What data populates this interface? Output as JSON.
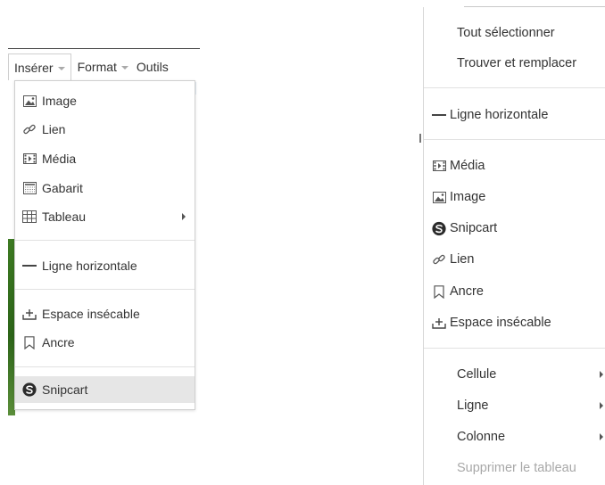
{
  "left_panel": {
    "menubar": {
      "insert_label": "Insérer",
      "format_label": "Format",
      "tools_label": "Outils"
    },
    "menu": {
      "image": "Image",
      "link": "Lien",
      "media": "Média",
      "template": "Gabarit",
      "table": "Tableau",
      "horizontal_line": "Ligne horizontale",
      "nonbreaking_space": "Espace insécable",
      "anchor": "Ancre",
      "snipcart": "Snipcart"
    }
  },
  "right_panel": {
    "menu": {
      "select_all": "Tout sélectionner",
      "find_replace": "Trouver et remplacer",
      "horizontal_line": "Ligne horizontale",
      "media": "Média",
      "image": "Image",
      "snipcart": "Snipcart",
      "link": "Lien",
      "anchor": "Ancre",
      "nonbreaking_space": "Espace insécable",
      "cell": "Cellule",
      "row": "Ligne",
      "column": "Colonne",
      "delete_table": "Supprimer le tableau"
    }
  },
  "icons": {
    "image": "image-icon",
    "link": "link-icon",
    "media": "media-icon",
    "template": "template-icon",
    "table": "table-icon",
    "horizontal_line": "horizontal-line-icon",
    "nonbreaking_space": "nonbreaking-space-icon",
    "anchor": "bookmark-icon",
    "snipcart": "snipcart-icon",
    "submenu": "chevron-right-icon",
    "dropdown": "caret-down-icon"
  },
  "colors": {
    "text": "#333333",
    "disabled_text": "#a8a8a8",
    "highlight": "#e6e6e6",
    "border": "#cfcfcf"
  }
}
